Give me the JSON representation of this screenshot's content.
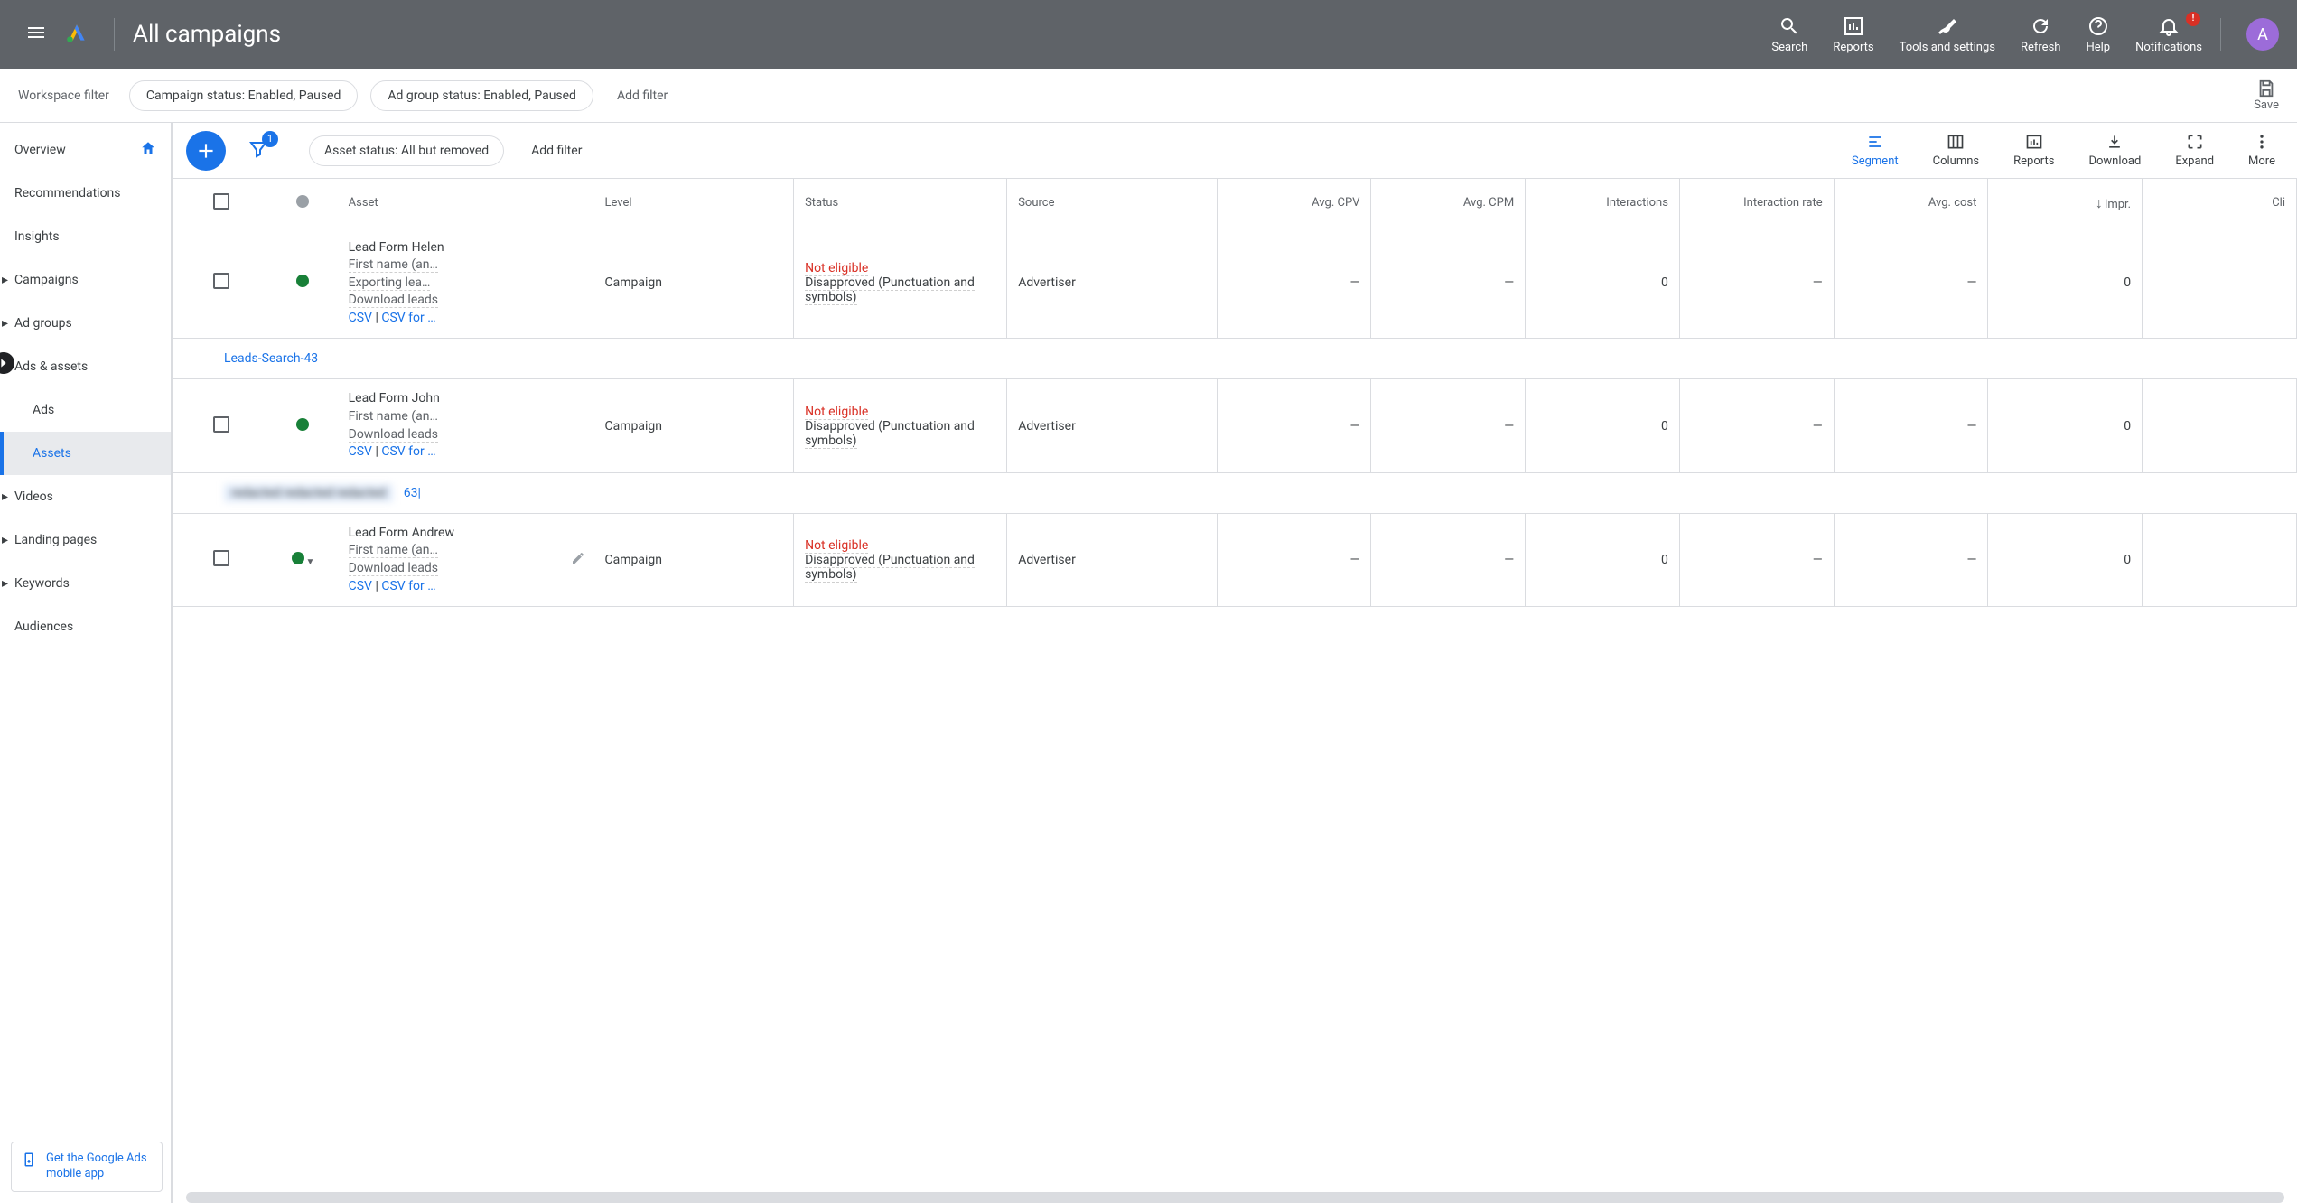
{
  "header": {
    "title": "All campaigns",
    "actions": {
      "search": "Search",
      "reports": "Reports",
      "tools": "Tools and settings",
      "refresh": "Refresh",
      "help": "Help",
      "notifications": "Notifications",
      "notif_badge": "!"
    },
    "avatar": "A"
  },
  "filter_bar": {
    "label": "Workspace filter",
    "chip1": "Campaign status: Enabled, Paused",
    "chip2": "Ad group status: Enabled, Paused",
    "add_filter": "Add filter",
    "save": "Save"
  },
  "sidebar": {
    "overview": "Overview",
    "recommendations": "Recommendations",
    "insights": "Insights",
    "campaigns": "Campaigns",
    "ad_groups": "Ad groups",
    "ads_assets": "Ads & assets",
    "ads": "Ads",
    "assets": "Assets",
    "videos": "Videos",
    "landing_pages": "Landing pages",
    "keywords": "Keywords",
    "audiences": "Audiences",
    "app_promo": "Get the Google Ads mobile app"
  },
  "toolbar": {
    "filter_badge": "1",
    "chip": "Asset status: All but removed",
    "add_filter": "Add filter",
    "segment": "Segment",
    "columns": "Columns",
    "reports": "Reports",
    "download": "Download",
    "expand": "Expand",
    "more": "More"
  },
  "table": {
    "headers": {
      "asset": "Asset",
      "level": "Level",
      "status": "Status",
      "source": "Source",
      "avg_cpv": "Avg. CPV",
      "avg_cpm": "Avg. CPM",
      "interactions": "Interactions",
      "interaction_rate": "Interaction rate",
      "avg_cost": "Avg. cost",
      "impr": "Impr.",
      "clicks": "Cli"
    },
    "rows": [
      {
        "asset_title": "Lead Form Helen",
        "asset_sub": "First name (an…",
        "asset_note": "Exporting lea…",
        "download_label": "Download leads",
        "csv": "CSV",
        "csv_for": "CSV for …",
        "level": "Campaign",
        "status_main": "Not eligible",
        "status_sub": "Disapproved (Punctuation and symbols)",
        "source": "Advertiser",
        "avg_cpv": "—",
        "avg_cpm": "—",
        "interactions": "0",
        "interaction_rate": "—",
        "avg_cost": "—",
        "impr": "0",
        "has_caret": false
      },
      {
        "asset_title": "Lead Form John",
        "asset_sub": "First name (an…",
        "asset_note": "",
        "download_label": "Download leads",
        "csv": "CSV",
        "csv_for": "CSV for …",
        "level": "Campaign",
        "status_main": "Not eligible",
        "status_sub": "Disapproved (Punctuation and symbols)",
        "source": "Advertiser",
        "avg_cpv": "—",
        "avg_cpm": "—",
        "interactions": "0",
        "interaction_rate": "—",
        "avg_cost": "—",
        "impr": "0",
        "has_caret": false
      },
      {
        "asset_title": "Lead Form Andrew",
        "asset_sub": "First name (an…",
        "asset_note": "",
        "download_label": "Download leads",
        "csv": "CSV",
        "csv_for": "CSV for …",
        "level": "Campaign",
        "status_main": "Not eligible",
        "status_sub": "Disapproved (Punctuation and symbols)",
        "source": "Advertiser",
        "avg_cpv": "—",
        "avg_cpm": "—",
        "interactions": "0",
        "interaction_rate": "—",
        "avg_cost": "—",
        "impr": "0",
        "has_caret": true
      }
    ],
    "sep1": "Leads-Search-43",
    "sep2_suffix": "63|",
    "sep2_blur": "redacted redacted redacted"
  }
}
